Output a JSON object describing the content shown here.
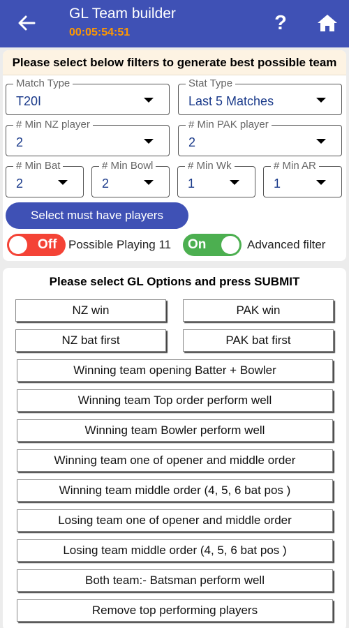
{
  "header": {
    "title": "GL Team builder",
    "timer": "00:05:54:51",
    "help_label": "?"
  },
  "filters": {
    "heading": "Please select below filters to generate best possible team",
    "match_type": {
      "label": "Match Type",
      "value": "T20I"
    },
    "stat_type": {
      "label": "Stat Type",
      "value": "Last 5 Matches"
    },
    "min_nz_player": {
      "label": "# Min NZ player",
      "value": "2"
    },
    "min_pak_player": {
      "label": "# Min PAK player",
      "value": "2"
    },
    "min_bat": {
      "label": "# Min Bat",
      "value": "2"
    },
    "min_bowl": {
      "label": "# Min Bowl",
      "value": "2"
    },
    "min_wk": {
      "label": "# Min Wk",
      "value": "1"
    },
    "min_ar": {
      "label": "# Min AR",
      "value": "1"
    },
    "must_have_button": "Select must have players",
    "possible_playing": {
      "state": "Off",
      "label": "Possible Playing 11",
      "color": "#f44336"
    },
    "advanced_filter": {
      "state": "On",
      "label": "Advanced filter",
      "color": "#4caf50"
    }
  },
  "gl_options": {
    "heading": "Please select GL Options and press SUBMIT",
    "nz_win": "NZ win",
    "pak_win": "PAK win",
    "nz_bat_first": "NZ bat first",
    "pak_bat_first": "PAK bat first",
    "options": [
      "Winning team opening Batter + Bowler",
      "Winning team Top order perform well",
      "Winning team Bowler perform well",
      "Winning team one of opener and middle order",
      "Winning team middle order (4, 5, 6 bat pos )",
      "Losing team one of opener and middle order",
      "Losing team middle order (4, 5, 6 bat pos )",
      "Both team:- Batsman perform well",
      "Remove top performing players"
    ]
  },
  "colors": {
    "primary": "#3f51b5",
    "timer": "#ff9800",
    "value_text": "#1a3a8a",
    "off": "#f44336",
    "on": "#4caf50"
  },
  "icons": {
    "back": "back-arrow-icon",
    "help": "help-icon",
    "home": "home-icon"
  }
}
